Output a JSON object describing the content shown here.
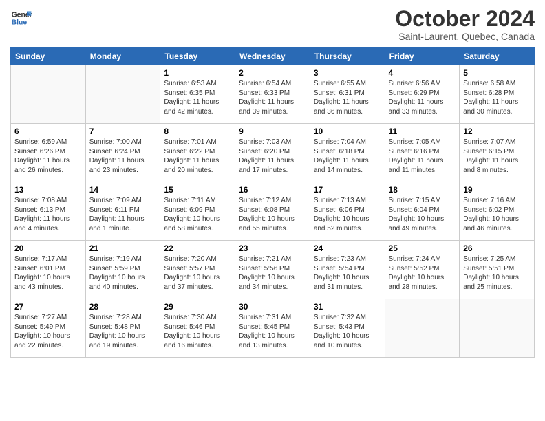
{
  "header": {
    "logo_general": "General",
    "logo_blue": "Blue",
    "month": "October 2024",
    "location": "Saint-Laurent, Quebec, Canada"
  },
  "days_of_week": [
    "Sunday",
    "Monday",
    "Tuesday",
    "Wednesday",
    "Thursday",
    "Friday",
    "Saturday"
  ],
  "weeks": [
    [
      {
        "day": "",
        "info": ""
      },
      {
        "day": "",
        "info": ""
      },
      {
        "day": "1",
        "info": "Sunrise: 6:53 AM\nSunset: 6:35 PM\nDaylight: 11 hours and 42 minutes."
      },
      {
        "day": "2",
        "info": "Sunrise: 6:54 AM\nSunset: 6:33 PM\nDaylight: 11 hours and 39 minutes."
      },
      {
        "day": "3",
        "info": "Sunrise: 6:55 AM\nSunset: 6:31 PM\nDaylight: 11 hours and 36 minutes."
      },
      {
        "day": "4",
        "info": "Sunrise: 6:56 AM\nSunset: 6:29 PM\nDaylight: 11 hours and 33 minutes."
      },
      {
        "day": "5",
        "info": "Sunrise: 6:58 AM\nSunset: 6:28 PM\nDaylight: 11 hours and 30 minutes."
      }
    ],
    [
      {
        "day": "6",
        "info": "Sunrise: 6:59 AM\nSunset: 6:26 PM\nDaylight: 11 hours and 26 minutes."
      },
      {
        "day": "7",
        "info": "Sunrise: 7:00 AM\nSunset: 6:24 PM\nDaylight: 11 hours and 23 minutes."
      },
      {
        "day": "8",
        "info": "Sunrise: 7:01 AM\nSunset: 6:22 PM\nDaylight: 11 hours and 20 minutes."
      },
      {
        "day": "9",
        "info": "Sunrise: 7:03 AM\nSunset: 6:20 PM\nDaylight: 11 hours and 17 minutes."
      },
      {
        "day": "10",
        "info": "Sunrise: 7:04 AM\nSunset: 6:18 PM\nDaylight: 11 hours and 14 minutes."
      },
      {
        "day": "11",
        "info": "Sunrise: 7:05 AM\nSunset: 6:16 PM\nDaylight: 11 hours and 11 minutes."
      },
      {
        "day": "12",
        "info": "Sunrise: 7:07 AM\nSunset: 6:15 PM\nDaylight: 11 hours and 8 minutes."
      }
    ],
    [
      {
        "day": "13",
        "info": "Sunrise: 7:08 AM\nSunset: 6:13 PM\nDaylight: 11 hours and 4 minutes."
      },
      {
        "day": "14",
        "info": "Sunrise: 7:09 AM\nSunset: 6:11 PM\nDaylight: 11 hours and 1 minute."
      },
      {
        "day": "15",
        "info": "Sunrise: 7:11 AM\nSunset: 6:09 PM\nDaylight: 10 hours and 58 minutes."
      },
      {
        "day": "16",
        "info": "Sunrise: 7:12 AM\nSunset: 6:08 PM\nDaylight: 10 hours and 55 minutes."
      },
      {
        "day": "17",
        "info": "Sunrise: 7:13 AM\nSunset: 6:06 PM\nDaylight: 10 hours and 52 minutes."
      },
      {
        "day": "18",
        "info": "Sunrise: 7:15 AM\nSunset: 6:04 PM\nDaylight: 10 hours and 49 minutes."
      },
      {
        "day": "19",
        "info": "Sunrise: 7:16 AM\nSunset: 6:02 PM\nDaylight: 10 hours and 46 minutes."
      }
    ],
    [
      {
        "day": "20",
        "info": "Sunrise: 7:17 AM\nSunset: 6:01 PM\nDaylight: 10 hours and 43 minutes."
      },
      {
        "day": "21",
        "info": "Sunrise: 7:19 AM\nSunset: 5:59 PM\nDaylight: 10 hours and 40 minutes."
      },
      {
        "day": "22",
        "info": "Sunrise: 7:20 AM\nSunset: 5:57 PM\nDaylight: 10 hours and 37 minutes."
      },
      {
        "day": "23",
        "info": "Sunrise: 7:21 AM\nSunset: 5:56 PM\nDaylight: 10 hours and 34 minutes."
      },
      {
        "day": "24",
        "info": "Sunrise: 7:23 AM\nSunset: 5:54 PM\nDaylight: 10 hours and 31 minutes."
      },
      {
        "day": "25",
        "info": "Sunrise: 7:24 AM\nSunset: 5:52 PM\nDaylight: 10 hours and 28 minutes."
      },
      {
        "day": "26",
        "info": "Sunrise: 7:25 AM\nSunset: 5:51 PM\nDaylight: 10 hours and 25 minutes."
      }
    ],
    [
      {
        "day": "27",
        "info": "Sunrise: 7:27 AM\nSunset: 5:49 PM\nDaylight: 10 hours and 22 minutes."
      },
      {
        "day": "28",
        "info": "Sunrise: 7:28 AM\nSunset: 5:48 PM\nDaylight: 10 hours and 19 minutes."
      },
      {
        "day": "29",
        "info": "Sunrise: 7:30 AM\nSunset: 5:46 PM\nDaylight: 10 hours and 16 minutes."
      },
      {
        "day": "30",
        "info": "Sunrise: 7:31 AM\nSunset: 5:45 PM\nDaylight: 10 hours and 13 minutes."
      },
      {
        "day": "31",
        "info": "Sunrise: 7:32 AM\nSunset: 5:43 PM\nDaylight: 10 hours and 10 minutes."
      },
      {
        "day": "",
        "info": ""
      },
      {
        "day": "",
        "info": ""
      }
    ]
  ]
}
